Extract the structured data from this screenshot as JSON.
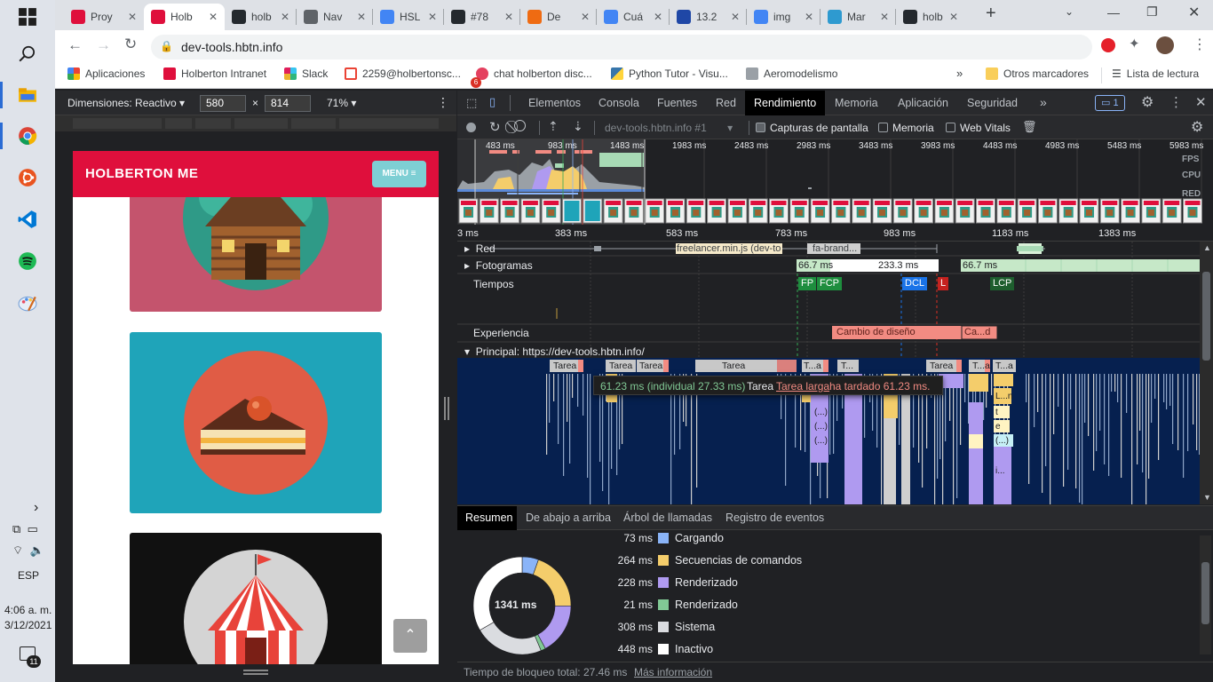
{
  "taskbar": {
    "language": "ESP",
    "time": "4:06 a. m.",
    "date": "3/12/2021",
    "notification_count": "11"
  },
  "browser": {
    "tabs": [
      {
        "label": "Proy",
        "color": "#df0f3c"
      },
      {
        "label": "Holb",
        "color": "#df0f3c"
      },
      {
        "label": "holb",
        "color": "#24292e"
      },
      {
        "label": "Nav",
        "color": "#5f6368"
      },
      {
        "label": "HSL",
        "color": "#4285f4"
      },
      {
        "label": "#78",
        "color": "#24292e"
      },
      {
        "label": "De",
        "color": "#ef6b12"
      },
      {
        "label": "Cuá",
        "color": "#4285f4"
      },
      {
        "label": "13.2",
        "color": "#1f47a6"
      },
      {
        "label": "img",
        "color": "#4285f4"
      },
      {
        "label": "Mar",
        "color": "#2e9ad0"
      },
      {
        "label": "holb",
        "color": "#24292e"
      }
    ],
    "url": "dev-tools.hbtn.info",
    "bookmarks": [
      "Aplicaciones",
      "Holberton Intranet",
      "Slack",
      "2259@holbertonsc...",
      "chat holberton disc...",
      "Python Tutor - Visu...",
      "Aeromodelismo"
    ],
    "other_bookmarks": "Otros marcadores",
    "reading_list": "Lista de lectura",
    "badge_count": "6"
  },
  "device_toolbar": {
    "dimensions_label": "Dimensiones: Reactivo",
    "width": "580",
    "height": "814",
    "times": "×",
    "zoom": "71%"
  },
  "site": {
    "brand": "HOLBERTON ME",
    "menu_label": "MENU"
  },
  "devtools": {
    "tabs": [
      "Elementos",
      "Consola",
      "Fuentes",
      "Red",
      "Rendimiento",
      "Memoria",
      "Aplicación",
      "Seguridad"
    ],
    "issues_count": "1",
    "recording_target": "dev-tools.hbtn.info #1",
    "checkboxes": [
      {
        "label": "Capturas de pantalla",
        "checked": true
      },
      {
        "label": "Memoria",
        "checked": false
      },
      {
        "label": "Web Vitals",
        "checked": false
      }
    ],
    "overview_ticks": [
      "483 ms",
      "983 ms",
      "1483 ms",
      "1983 ms",
      "2483 ms",
      "2983 ms",
      "3483 ms",
      "3983 ms",
      "4483 ms",
      "4983 ms",
      "5483 ms",
      "5983 ms"
    ],
    "overview_labels": [
      "FPS",
      "CPU",
      "RED"
    ],
    "timeline_ticks": [
      "3 ms",
      "383 ms",
      "583 ms",
      "783 ms",
      "983 ms",
      "1183 ms",
      "1383 ms"
    ],
    "tracks": {
      "network": "Red",
      "network_items": [
        "freelancer.min.js (dev-to",
        "fa-brand..."
      ],
      "frames": "Fotogramas",
      "frame_values": [
        "66.7 ms",
        "233.3 ms",
        "66.7 ms"
      ],
      "timings": "Tiempos",
      "timing_markers": [
        "FP",
        "FCP",
        "DCL",
        "L",
        "LCP"
      ],
      "experience": "Experiencia",
      "layout_shift": "Cambio de diseño",
      "layout_shift_short": "Ca...d",
      "main": "Principal: https://dev-tools.hbtn.info/"
    },
    "flame_labels": [
      "Tarea",
      "Tarea",
      "Tarea",
      "Tarea",
      "T...a",
      "T...",
      "Tarea",
      "T...a",
      "T...a"
    ],
    "flame_sub_labels": [
      "(...)",
      "(...)",
      "(...)",
      "L...n",
      "t",
      "e",
      "(...)",
      "i..."
    ],
    "tooltip": {
      "duration": "61.23 ms (individual 27.33 ms)",
      "name": "Tarea",
      "link": "Tarea larga",
      "suffix": "ha tardado 61.23 ms."
    },
    "summary_tabs": [
      "Resumen",
      "De abajo a arriba",
      "Árbol de llamadas",
      "Registro de eventos"
    ],
    "total_label": "1341 ms",
    "summary": [
      {
        "value": "73 ms",
        "label": "Cargando",
        "color": "#8ab4f8"
      },
      {
        "value": "264 ms",
        "label": "Secuencias de comandos",
        "color": "#f4cd6b"
      },
      {
        "value": "228 ms",
        "label": "Renderizado",
        "color": "#af9af0"
      },
      {
        "value": "21 ms",
        "label": "Renderizado",
        "color": "#81c995"
      },
      {
        "value": "308 ms",
        "label": "Sistema",
        "color": "#dadce0"
      },
      {
        "value": "448 ms",
        "label": "Inactivo",
        "color": "#ffffff"
      }
    ],
    "status_text": "Tiempo de bloqueo total: 27.46 ms",
    "status_link": "Más información"
  }
}
